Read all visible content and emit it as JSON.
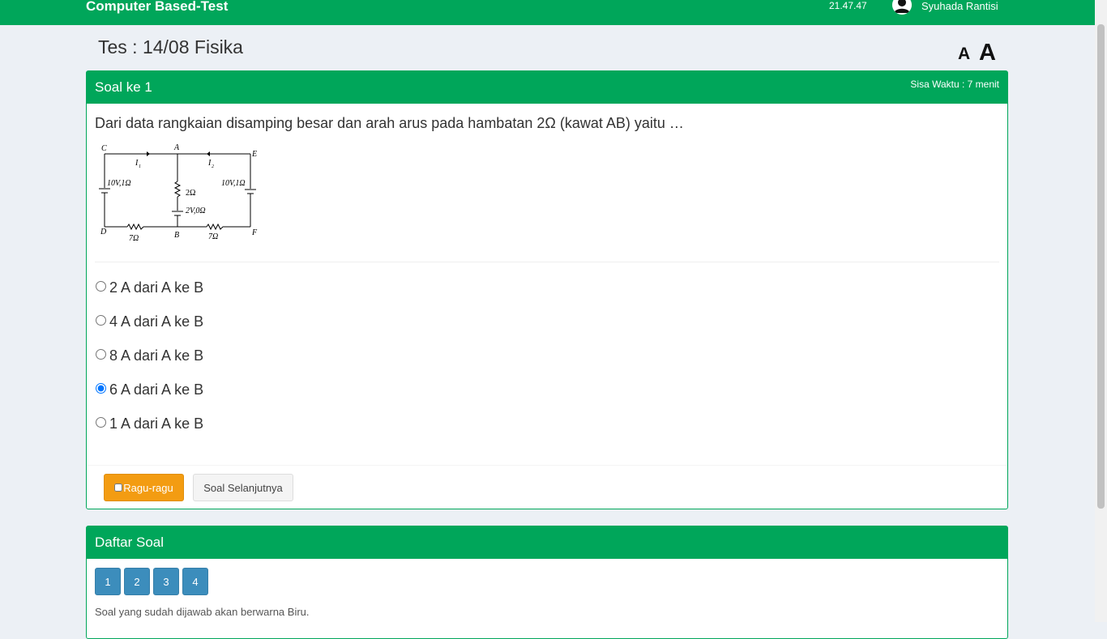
{
  "header": {
    "brand": "Computer Based-Test",
    "time": "21.47.47",
    "user_name": "Syuhada Rantisi"
  },
  "page": {
    "title": "Tes : 14/08 Fisika",
    "font_small_label": "A",
    "font_large_label": "A"
  },
  "question": {
    "header_title": "Soal ke 1",
    "timer": "Sisa Waktu : 7 menit",
    "text": "Dari data rangkaian disamping besar dan arah arus pada hambatan 2Ω (kawat AB) yaitu …",
    "circuit_labels": {
      "c": "C",
      "a": "A",
      "e": "E",
      "d": "D",
      "b": "B",
      "f": "F",
      "i1": "I",
      "i1_sub": "1",
      "i2": "I",
      "i2_sub": "2",
      "left_source": "10V,1Ω",
      "right_source": "10V,1Ω",
      "mid_resistor": "2Ω",
      "mid_source": "2V,0Ω",
      "left_resistor": "7Ω",
      "right_resistor": "7Ω"
    },
    "options": [
      {
        "label": "2 A dari A ke B",
        "checked": false
      },
      {
        "label": "4 A dari A ke B",
        "checked": false
      },
      {
        "label": "8 A dari A ke B",
        "checked": false
      },
      {
        "label": "6 A dari A ke B",
        "checked": true
      },
      {
        "label": "1 A dari A ke B",
        "checked": false
      }
    ],
    "ragu_label": "Ragu-ragu",
    "next_label": "Soal Selanjutnya"
  },
  "question_list": {
    "header_title": "Daftar Soal",
    "numbers": [
      "1",
      "2",
      "3",
      "4"
    ],
    "note": "Soal yang sudah dijawab akan berwarna Biru."
  }
}
